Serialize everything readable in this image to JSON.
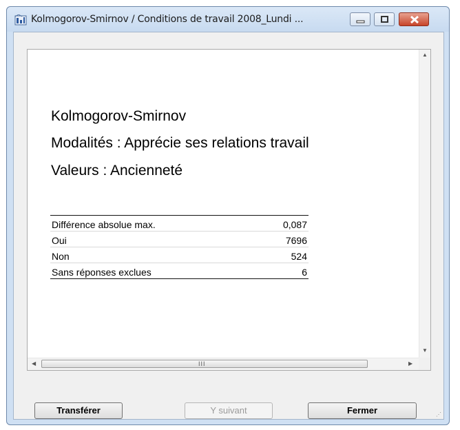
{
  "window": {
    "title": "Kolmogorov-Smirnov / Conditions de travail 2008_Lundi ...",
    "icon": "app-icon"
  },
  "report": {
    "title": "Kolmogorov-Smirnov",
    "modalites": "Modalités : Apprécie ses relations travail",
    "valeurs": "Valeurs : Ancienneté",
    "rows": [
      {
        "label": "Différence absolue max.",
        "value": "0,087"
      },
      {
        "label": "Oui",
        "value": "7696"
      },
      {
        "label": "Non",
        "value": "524"
      },
      {
        "label": "Sans réponses exclues",
        "value": "6"
      }
    ]
  },
  "scrollbar": {
    "grip": "III"
  },
  "buttons": {
    "transfer": "Transférer",
    "next": "Y suivant",
    "close": "Fermer"
  },
  "colors": {
    "titlebar": "#c7daf0",
    "close_button": "#c7442a"
  }
}
